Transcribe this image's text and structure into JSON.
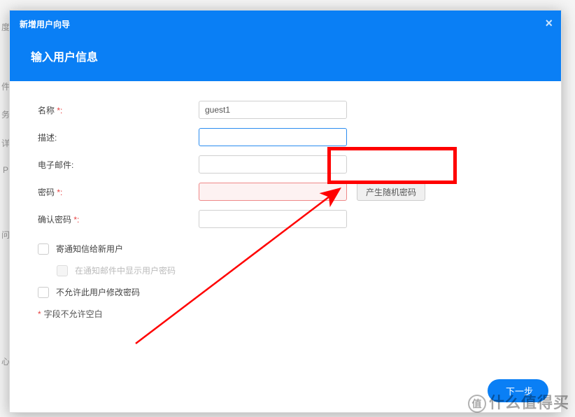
{
  "backdrop": {
    "t1": "度",
    "t2": "件",
    "t3": "务",
    "t4": "详",
    "t5": "P",
    "t6": "问",
    "t7": "心"
  },
  "modal": {
    "title": "新增用户向导",
    "subtitle": "输入用户信息"
  },
  "form": {
    "name": {
      "label": "名称",
      "value": "guest1"
    },
    "desc": {
      "label": "描述:",
      "value": ""
    },
    "email": {
      "label": "电子邮件:",
      "value": ""
    },
    "password": {
      "label": "密码",
      "value": ""
    },
    "confirm": {
      "label": "确认密码",
      "value": ""
    },
    "gen_random": "产生随机密码",
    "req_colon": "*:",
    "colon": ":"
  },
  "opts": {
    "notify": "寄通知信给新用户",
    "show_pw": "在通知邮件中显示用户密码",
    "no_change": "不允许此用户修改密码"
  },
  "footnote": {
    "star": "*",
    "text": "字段不允许空白"
  },
  "footer": {
    "next": "下一步"
  },
  "watermark": {
    "circ": "值",
    "text": "什么值得买"
  }
}
